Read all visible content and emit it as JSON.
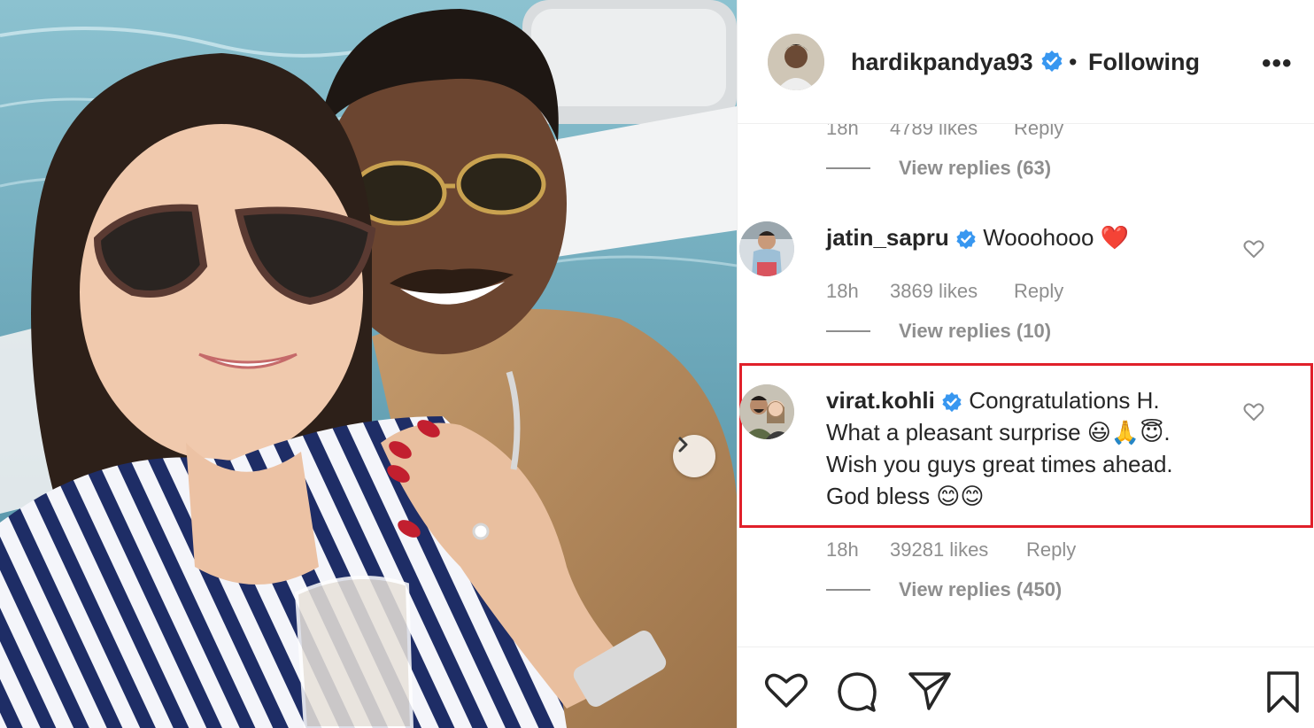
{
  "post": {
    "carousel_next_icon": "chevron-right-icon"
  },
  "header": {
    "username": "hardikpandya93",
    "separator": "•",
    "follow_status": "Following",
    "more_label": "•••"
  },
  "comments": [
    {
      "user": "",
      "text": "",
      "time": "18h",
      "likes": "4789 likes",
      "reply": "Reply",
      "view_replies": "View replies (63)"
    },
    {
      "user": "jatin_sapru",
      "verified": true,
      "text": "Wooohooo ❤️",
      "time": "18h",
      "likes": "3869 likes",
      "reply": "Reply",
      "view_replies": "View replies (10)"
    },
    {
      "user": "virat.kohli",
      "verified": true,
      "text_lines": [
        "Congratulations H.",
        "What a pleasant surprise 😃🙏😇.",
        "Wish you guys great times ahead.",
        "God bless 😊😊"
      ],
      "time": "18h",
      "likes": "39281 likes",
      "reply": "Reply",
      "view_replies": "View replies (450)",
      "highlighted": true
    }
  ],
  "actions": {
    "like_icon": "heart-icon",
    "comment_icon": "comment-icon",
    "share_icon": "paper-plane-icon",
    "save_icon": "bookmark-icon"
  },
  "colors": {
    "highlight_border": "#e0202a",
    "verified_blue": "#3897f0",
    "muted_text": "#8e8e8e",
    "text": "#262626"
  }
}
